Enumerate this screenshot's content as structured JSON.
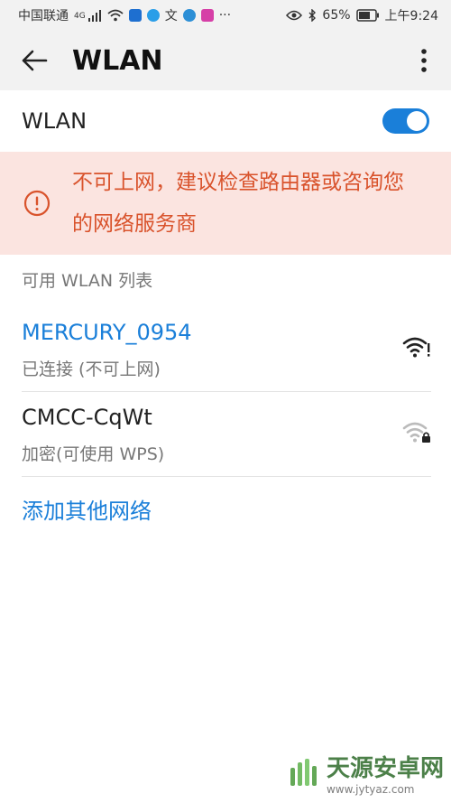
{
  "status_bar": {
    "carrier": "中国联通",
    "network": "4G",
    "battery": "65%",
    "time": "上午9:24",
    "more": "···"
  },
  "header": {
    "title": "WLAN"
  },
  "wlan_toggle": {
    "label": "WLAN",
    "enabled": true
  },
  "warning": {
    "message": "不可上网，建议检查路由器或咨询您的网络服务商"
  },
  "list": {
    "section_title": "可用 WLAN 列表",
    "networks": [
      {
        "name": "MERCURY_0954",
        "status": "已连接 (不可上网)",
        "connected": true
      },
      {
        "name": "CMCC-CqWt",
        "status": "加密(可使用 WPS)",
        "connected": false
      }
    ],
    "add_network": "添加其他网络"
  },
  "watermark": {
    "name": "天源安卓网",
    "url": "www.jytyaz.com"
  },
  "colors": {
    "accent": "#1a7fd9",
    "warning_bg": "#fbe4e0",
    "warning_text": "#d9532c"
  }
}
